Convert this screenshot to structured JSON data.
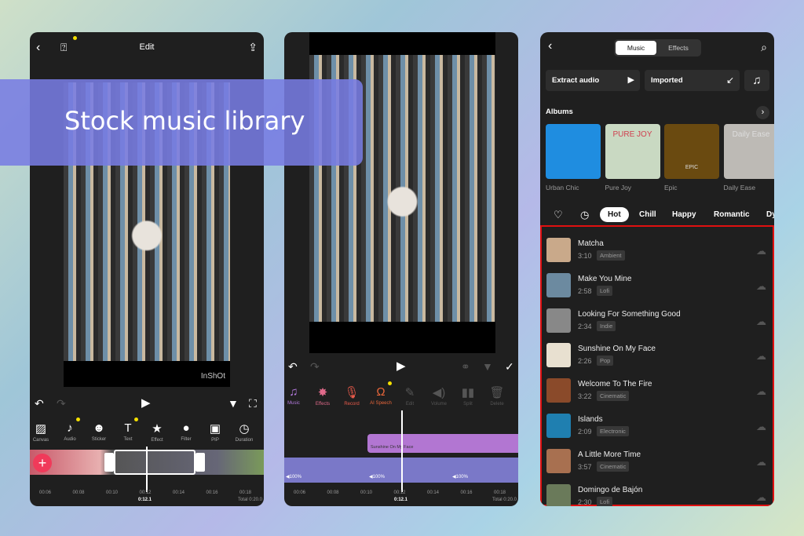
{
  "banner": {
    "title": "Stock music library"
  },
  "editor": {
    "title": "Edit",
    "watermark": "InShOt",
    "tools": [
      {
        "icon": "canvas-icon",
        "glyph": "▨",
        "label": "Canvas"
      },
      {
        "icon": "audio-icon",
        "glyph": "♪",
        "label": "Audio"
      },
      {
        "icon": "sticker-icon",
        "glyph": "☻",
        "label": "Sticker"
      },
      {
        "icon": "text-icon",
        "glyph": "T",
        "label": "Text"
      },
      {
        "icon": "effect-icon",
        "glyph": "★",
        "label": "Effect"
      },
      {
        "icon": "filter-icon",
        "glyph": "●",
        "label": "Filter"
      },
      {
        "icon": "pip-icon",
        "glyph": "▣",
        "label": "PIP"
      },
      {
        "icon": "duration-icon",
        "glyph": "◷",
        "label": "Duration"
      }
    ],
    "ruler": [
      "00:06",
      "00:08",
      "00:10",
      "00:12",
      "00:14",
      "00:16",
      "00:18"
    ],
    "current": "0:12.1",
    "total": "Total 0:20.0"
  },
  "audio_editor": {
    "tools": [
      {
        "icon": "music-icon",
        "glyph": "♫",
        "label": "Music",
        "color": "#b67be0"
      },
      {
        "icon": "effects-icon",
        "glyph": "✸",
        "label": "Effects",
        "color": "#e06a8a"
      },
      {
        "icon": "record-icon",
        "glyph": "🎙",
        "label": "Record",
        "color": "#e85a4a"
      },
      {
        "icon": "ai-speech-icon",
        "glyph": "Ω",
        "label": "AI Speech",
        "color": "#e8663a"
      },
      {
        "icon": "edit-icon",
        "glyph": "✎",
        "label": "Edit",
        "color": "#555"
      },
      {
        "icon": "volume-icon",
        "glyph": "◀)",
        "label": "Volume",
        "color": "#555"
      },
      {
        "icon": "split-icon",
        "glyph": "▮▮",
        "label": "Split",
        "color": "#555"
      },
      {
        "icon": "delete-icon",
        "glyph": "🗑",
        "label": "Delete",
        "color": "#555"
      }
    ],
    "audio_clip": "Sunshine On My Face",
    "volumes": [
      "100%",
      "100%",
      "100%"
    ],
    "ruler": [
      "00:06",
      "00:08",
      "00:10",
      "00:12",
      "00:14",
      "00:16",
      "00:18"
    ],
    "current": "0:12.1",
    "total": "Total 0:20.0"
  },
  "music": {
    "tabs": [
      "Music",
      "Effects"
    ],
    "extract": "Extract audio",
    "imported": "Imported",
    "albums_title": "Albums",
    "albums": [
      {
        "name": "Urban Chic",
        "color": "#1f8de0"
      },
      {
        "name": "Pure Joy",
        "color": "#c9d9c2"
      },
      {
        "name": "Epic",
        "color": "#6a4a10"
      },
      {
        "name": "Daily Ease",
        "color": "#bdbab5"
      }
    ],
    "album_cover_texts": [
      "PURE JOY",
      "EPIC",
      "Daily Ease"
    ],
    "categories": [
      "Hot",
      "Chill",
      "Happy",
      "Romantic",
      "Dy"
    ],
    "songs": [
      {
        "title": "Matcha",
        "duration": "3:10",
        "genre": "Ambient",
        "color": "#c9a98a"
      },
      {
        "title": "Make You Mine",
        "duration": "2:58",
        "genre": "Lofi",
        "color": "#6c8aa0"
      },
      {
        "title": "Looking For Something Good",
        "duration": "2:34",
        "genre": "Indie",
        "color": "#888"
      },
      {
        "title": "Sunshine On My Face",
        "duration": "2:26",
        "genre": "Pop",
        "color": "#e8e0d0"
      },
      {
        "title": "Welcome To The Fire",
        "duration": "3:22",
        "genre": "Cinematic",
        "color": "#8a4a2a"
      },
      {
        "title": "Islands",
        "duration": "2:09",
        "genre": "Electronic",
        "color": "#1f7fb0"
      },
      {
        "title": "A Little More Time",
        "duration": "3:57",
        "genre": "Cinematic",
        "color": "#a87050"
      },
      {
        "title": "Domingo de Bajón",
        "duration": "2:30",
        "genre": "Lofi",
        "color": "#6a7a5a"
      }
    ]
  }
}
